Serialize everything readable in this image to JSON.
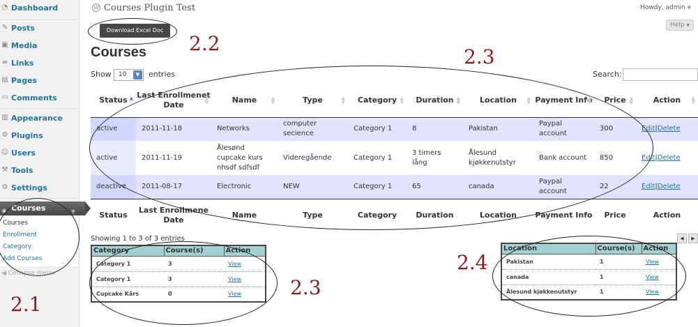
{
  "sidebar": {
    "items": [
      {
        "label": "Dashboard",
        "icon": "dashboard-icon"
      },
      {
        "label": "Posts",
        "icon": "pin-icon"
      },
      {
        "label": "Media",
        "icon": "media-icon"
      },
      {
        "label": "Links",
        "icon": "link-icon"
      },
      {
        "label": "Pages",
        "icon": "page-icon"
      },
      {
        "label": "Comments",
        "icon": "comment-icon"
      },
      {
        "label": "Appearance",
        "icon": "appearance-icon"
      },
      {
        "label": "Plugins",
        "icon": "plugin-icon"
      },
      {
        "label": "Users",
        "icon": "users-icon"
      },
      {
        "label": "Tools",
        "icon": "tools-icon"
      },
      {
        "label": "Settings",
        "icon": "settings-icon"
      }
    ],
    "courses_label": "Courses",
    "submenu": [
      "Courses",
      "Enrollment",
      "Category",
      "Add Courses"
    ],
    "collapse": "Collapse menu"
  },
  "header": {
    "site_title": "Courses Plugin Test",
    "howdy": "Howdy, admin",
    "help": "Help"
  },
  "download_label": "Download Excel Doc",
  "page_title": "Courses",
  "controls": {
    "show": "Show",
    "length": "10",
    "entries": "entries",
    "search": "Search:"
  },
  "table": {
    "columns": [
      "Status",
      "Last Enrollmenet Date",
      "Name",
      "Type",
      "Category",
      "Duration",
      "Location",
      "Payment Info",
      "Price",
      "Action"
    ],
    "footer_columns": [
      "Status",
      "Last Enrollmene Date",
      "Name",
      "Type",
      "Category",
      "Duration",
      "Location",
      "Payment Info",
      "Price",
      "Action"
    ],
    "rows": [
      {
        "status": "active",
        "date": "2011-11-18",
        "name": "Networks",
        "type": "computer secience",
        "category": "Category 1",
        "duration": "8",
        "location": "Pakistan",
        "payment": "Paypal account",
        "price": "300",
        "edit": "Edit",
        "sep": "|",
        "delete": "Delete"
      },
      {
        "status": "active",
        "date": "2011-11-19",
        "name": "Ålesønd cupcake kurs nhsdf sdfsdf",
        "type": "Videregående",
        "category": "Category 1",
        "duration": "3 timers lång",
        "location": "Ålesund kjøkkenutstyr",
        "payment": "Bank account",
        "price": "850",
        "edit": "Edit",
        "sep": "|",
        "delete": "Delete"
      },
      {
        "status": "deactive",
        "date": "2011-08-17",
        "name": "Electronic",
        "type": "NEW",
        "category": "Category 1",
        "duration": "65",
        "location": "canada",
        "payment": "Paypal account",
        "price": "22",
        "edit": "Edit",
        "sep": "|",
        "delete": "Delete"
      }
    ]
  },
  "info": "Showing 1 to 3 of 3 entries",
  "pager": {
    "prev": "◀",
    "next": "▶"
  },
  "category_table": {
    "headers": [
      "Category",
      "Course(s)",
      "Action"
    ],
    "rows": [
      {
        "name": "Category 1",
        "count": "3",
        "action": "View"
      },
      {
        "name": "Category 1",
        "count": "3",
        "action": "View"
      },
      {
        "name": "Cupcake Kårs",
        "count": "0",
        "action": "View"
      }
    ]
  },
  "location_table": {
    "headers": [
      "Location",
      "Course(s)",
      "Action"
    ],
    "rows": [
      {
        "name": "Pakistan",
        "count": "1",
        "action": "View"
      },
      {
        "name": "canada",
        "count": "1",
        "action": "View"
      },
      {
        "name": "Ålesund kjøkkenutstyr",
        "count": "1",
        "action": "View"
      }
    ]
  },
  "annotations": {
    "a21": "2.1",
    "a22": "2.2",
    "a23a": "2.3",
    "a23b": "2.3",
    "a24": "2.4"
  }
}
